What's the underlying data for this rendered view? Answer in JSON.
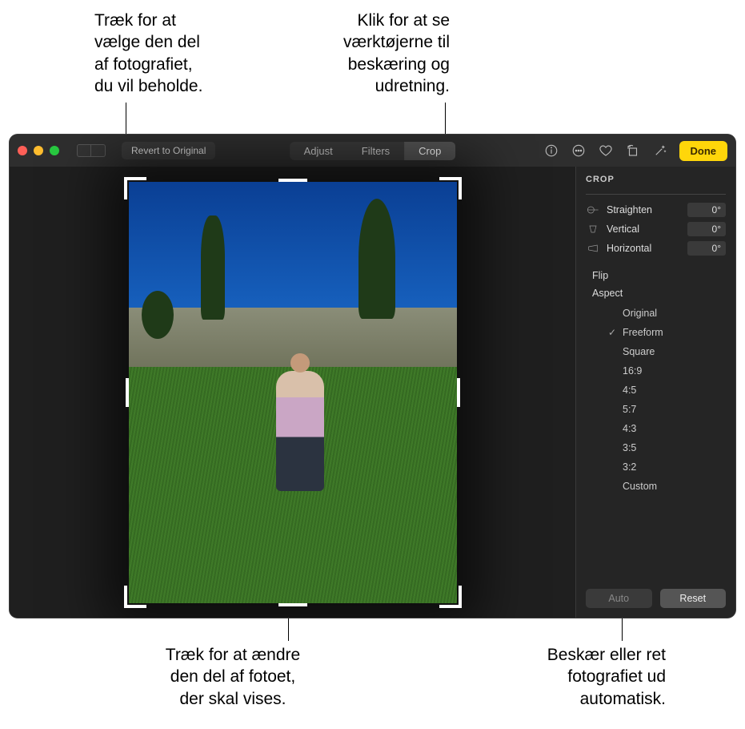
{
  "callouts": {
    "top_left": "Træk for at\nvælge den del\naf fotografiet,\ndu vil beholde.",
    "top_right": "Klik for at se\nværktøjerne til\nbeskæring og\nudretning.",
    "bottom_left": "Træk for at ændre\nden del af fotoet,\nder skal vises.",
    "bottom_right": "Beskær eller ret\nfotografiet ud\nautomatisk."
  },
  "toolbar": {
    "revert_label": "Revert to Original",
    "tabs": {
      "adjust": "Adjust",
      "filters": "Filters",
      "crop": "Crop"
    },
    "done_label": "Done"
  },
  "sidebar": {
    "title": "CROP",
    "straighten": {
      "label": "Straighten",
      "value": "0°"
    },
    "vertical": {
      "label": "Vertical",
      "value": "0°"
    },
    "horizontal": {
      "label": "Horizontal",
      "value": "0°"
    },
    "flip_label": "Flip",
    "aspect_label": "Aspect",
    "aspect_options": [
      "Original",
      "Freeform",
      "Square",
      "16:9",
      "4:5",
      "5:7",
      "4:3",
      "3:5",
      "3:2",
      "Custom"
    ],
    "aspect_selected": "Freeform",
    "auto_label": "Auto",
    "reset_label": "Reset"
  }
}
